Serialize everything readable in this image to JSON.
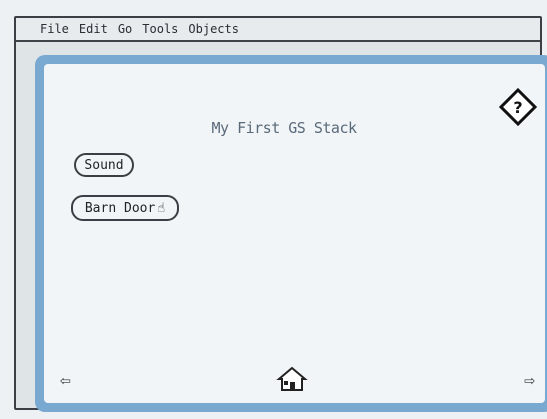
{
  "menu": {
    "apple_icon": "apple-icon",
    "items": [
      "File",
      "Edit",
      "Go",
      "Tools",
      "Objects"
    ]
  },
  "card": {
    "title": "My First GS Stack",
    "buttons": {
      "sound": "Sound",
      "barn_door": "Barn Door"
    }
  },
  "icons": {
    "help": "help-icon",
    "home": "home-icon",
    "back": "left-arrow-icon",
    "forward": "right-arrow-icon",
    "cursor": "hand-cursor-icon"
  },
  "colors": {
    "border_blue": "#79a8d0",
    "background": "#f2f5f7"
  }
}
